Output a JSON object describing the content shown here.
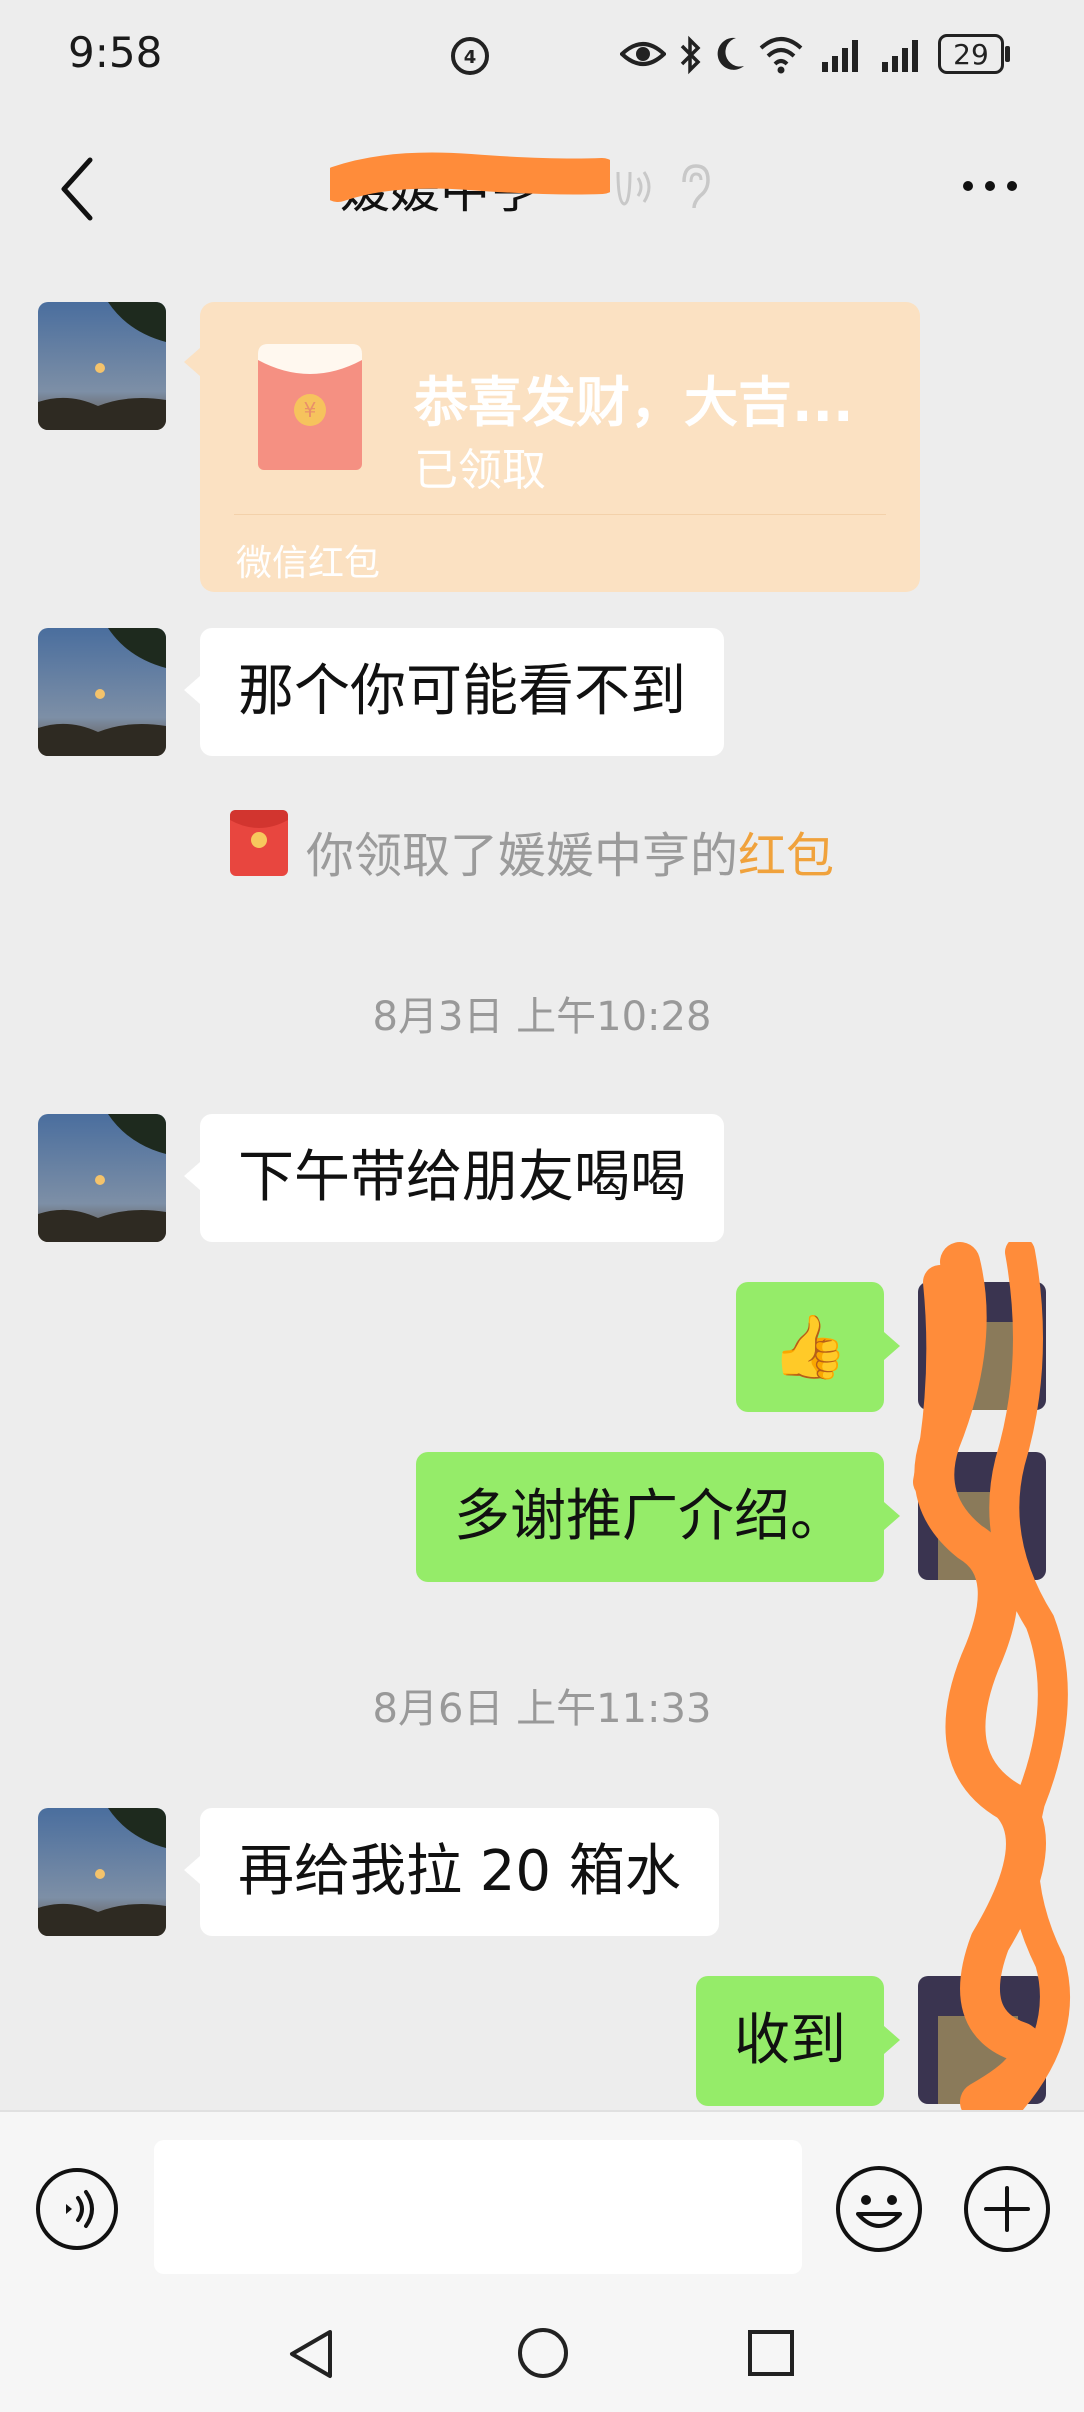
{
  "status_bar": {
    "time": "9:58",
    "battery": "29",
    "icons": [
      "hd-icon",
      "eye-icon",
      "bluetooth-icon",
      "moon-icon",
      "wifi-icon",
      "signal-icon",
      "signal-icon",
      "battery-icon"
    ]
  },
  "header": {
    "title": "媛媛中亨",
    "back_icon": "chevron-left-icon",
    "more_icon": "more-icon",
    "ear_icon": "ear-icon"
  },
  "messages": [
    {
      "type": "red_packet",
      "side": "left",
      "title": "恭喜发财，大吉...",
      "status": "已领取",
      "label": "微信红包"
    },
    {
      "type": "text",
      "side": "left",
      "text": "那个你可能看不到"
    },
    {
      "type": "system",
      "prefix": "你领取了媛媛中亨的",
      "link": "红包"
    },
    {
      "type": "time",
      "text": "8月3日 上午10:28"
    },
    {
      "type": "text",
      "side": "left",
      "text": "下午带给朋友喝喝"
    },
    {
      "type": "emoji",
      "side": "right",
      "emoji": "👍"
    },
    {
      "type": "text",
      "side": "right",
      "text": "多谢推广介绍。"
    },
    {
      "type": "time",
      "text": "8月6日 上午11:33"
    },
    {
      "type": "text",
      "side": "left",
      "text": "再给我拉 20 箱水"
    },
    {
      "type": "text",
      "side": "right",
      "text": "收到"
    }
  ],
  "input_bar": {
    "placeholder": "",
    "voice_icon": "voice-icon",
    "emoji_icon": "smiley-icon",
    "plus_icon": "plus-icon"
  },
  "nav_bar": {
    "icons": [
      "back-triangle-icon",
      "home-circle-icon",
      "recents-square-icon"
    ]
  },
  "colors": {
    "background": "#ededed",
    "outgoing_bubble": "#95ec69",
    "incoming_bubble": "#ffffff",
    "red_packet": "#fbe1c2",
    "link": "#f0a23c",
    "redaction": "#ff8c3a"
  }
}
